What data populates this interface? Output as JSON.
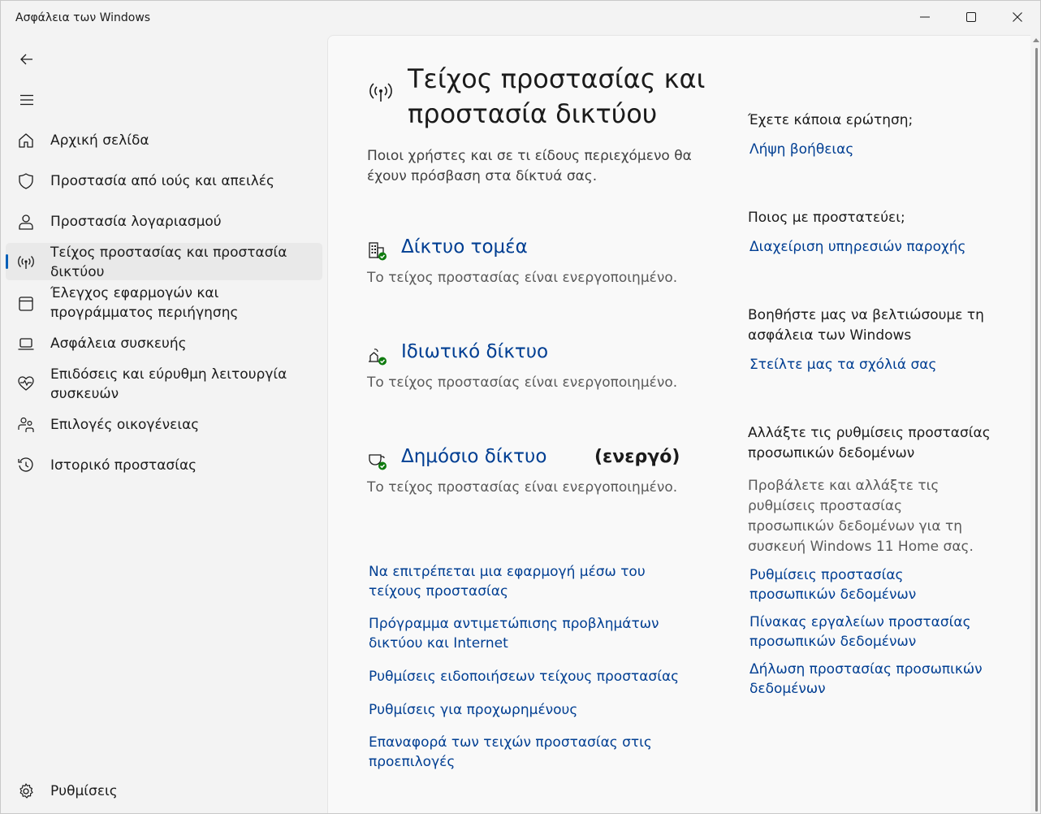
{
  "window": {
    "title": "Ασφάλεια των Windows"
  },
  "sidebar": {
    "items": [
      {
        "label": "Αρχική σελίδα",
        "icon": "home-icon"
      },
      {
        "label": "Προστασία από ιούς και απειλές",
        "icon": "shield-icon"
      },
      {
        "label": "Προστασία λογαριασμού",
        "icon": "person-icon"
      },
      {
        "label": "Τείχος προστασίας και προστασία δικτύου",
        "icon": "antenna-icon",
        "active": true
      },
      {
        "label": "Έλεγχος εφαρμογών και προγράμματος περιήγησης",
        "icon": "app-browser-icon"
      },
      {
        "label": "Ασφάλεια συσκευής",
        "icon": "laptop-icon"
      },
      {
        "label": "Επιδόσεις και εύρυθμη λειτουργία συσκευών",
        "icon": "heart-pulse-icon"
      },
      {
        "label": "Επιλογές οικογένειας",
        "icon": "family-icon"
      },
      {
        "label": "Ιστορικό προστασίας",
        "icon": "history-icon"
      }
    ],
    "settings_label": "Ρυθμίσεις"
  },
  "main": {
    "title": "Τείχος προστασίας και προστασία δικτύου",
    "description": "Ποιοι χρήστες και σε τι είδους περιεχόμενο θα έχουν πρόσβαση στα δίκτυά σας.",
    "networks": [
      {
        "name": "Δίκτυο τομέα",
        "status": "Το τείχος προστασίας είναι ενεργοποιημένο.",
        "icon": "domain-network-icon"
      },
      {
        "name": "Ιδιωτικό δίκτυο",
        "status": "Το τείχος προστασίας είναι ενεργοποιημένο.",
        "icon": "private-network-icon"
      },
      {
        "name": "Δημόσιο δίκτυο",
        "active_label": "(ενεργό)",
        "status": "Το τείχος προστασίας είναι ενεργοποιημένο.",
        "icon": "public-network-icon"
      }
    ],
    "links": [
      "Να επιτρέπεται μια εφαρμογή μέσω του τείχους προστασίας",
      "Πρόγραμμα αντιμετώπισης προβλημάτων δικτύου και Internet",
      "Ρυθμίσεις ειδοποιήσεων τείχους προστασίας",
      "Ρυθμίσεις για προχωρημένους",
      "Επαναφορά των τειχών προστασίας στις προεπιλογές"
    ]
  },
  "right_panel": {
    "question_heading": "Έχετε κάποια ερώτηση;",
    "help_link": "Λήψη βοήθειας",
    "protect_heading": "Ποιος με προστατεύει;",
    "providers_link": "Διαχείριση υπηρεσιών παροχής",
    "improve_heading": "Βοηθήστε μας να βελτιώσουμε τη ασφάλεια των Windows",
    "feedback_link": "Στείλτε μας τα σχόλιά σας",
    "privacy_heading": "Αλλάξτε τις ρυθμίσεις προστασίας προσωπικών δεδομένων",
    "privacy_text": "Προβάλετε και αλλάξτε τις ρυθμίσεις προστασίας προσωπικών δεδομένων για τη συσκευή Windows 11 Home σας.",
    "privacy_links": [
      "Ρυθμίσεις προστασίας προσωπικών δεδομένων",
      "Πίνακας εργαλείων προστασίας προσωπικών δεδομένων",
      "Δήλωση προστασίας προσωπικών δεδομένων"
    ]
  },
  "colors": {
    "accent": "#005fb8",
    "link": "#003e92",
    "success": "#0f7b0f"
  }
}
